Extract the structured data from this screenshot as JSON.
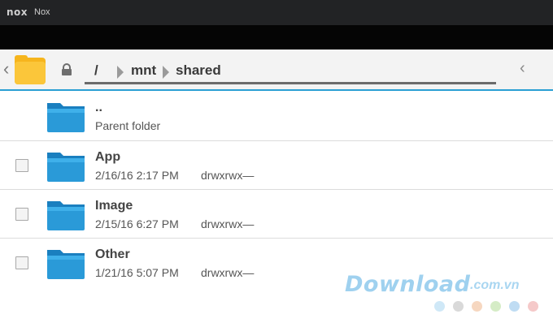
{
  "window": {
    "logo_text": "nox",
    "title": "Nox"
  },
  "toolbar": {
    "back_icon": "chevron-left-icon",
    "app_icon": "folder-app-icon",
    "lock_icon": "lock-icon",
    "breadcrumb": [
      "/",
      "mnt",
      "shared"
    ],
    "collapse_icon": "chevron-left-icon",
    "accent_color": "#2a9fd3"
  },
  "files": {
    "parent": {
      "name": "..",
      "subtitle": "Parent folder"
    },
    "items": [
      {
        "name": "App",
        "date": "2/16/16 2:17 PM",
        "perms": "drwxrwx—"
      },
      {
        "name": "Image",
        "date": "2/15/16 6:27 PM",
        "perms": "drwxrwx—"
      },
      {
        "name": "Other",
        "date": "1/21/16 5:07 PM",
        "perms": "drwxrwx—"
      }
    ],
    "folder_color": "#1f8fcf"
  },
  "watermark": {
    "text": "Download",
    "tld": ".com.vn",
    "dot_colors": [
      "#cfe8f7",
      "#d9d9d9",
      "#f6d7c0",
      "#d5ecc6",
      "#bfdcf3",
      "#f5c9c9"
    ]
  }
}
